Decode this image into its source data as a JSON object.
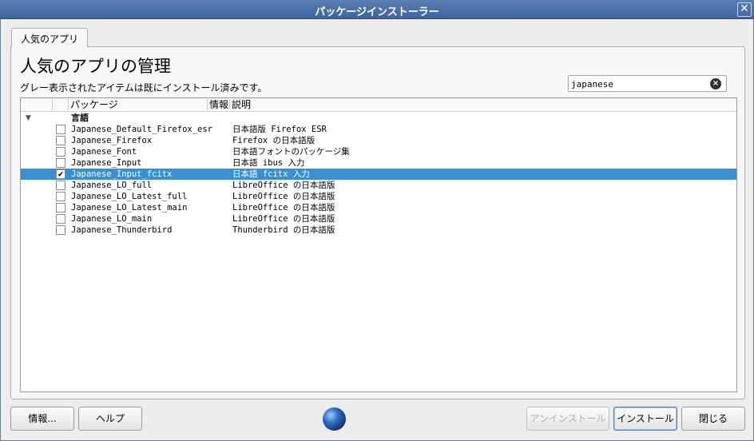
{
  "window": {
    "title": "パッケージインストーラー"
  },
  "tab": {
    "label": "人気のアプリ"
  },
  "heading": "人気のアプリの管理",
  "description": "グレー表示されたアイテムは既にインストール済みです。",
  "search": {
    "value": "japanese"
  },
  "columns": {
    "package": "パッケージ",
    "info": "情報",
    "desc": "説明"
  },
  "group": {
    "label": "言語"
  },
  "rows": [
    {
      "name": "Japanese_Default_Firefox_esr",
      "desc": "日本語版 Firefox ESR",
      "checked": false
    },
    {
      "name": "Japanese_Firefox",
      "desc": "Firefox の日本語版",
      "checked": false
    },
    {
      "name": "Japanese_Font",
      "desc": "日本語フォントのパッケージ集",
      "checked": false
    },
    {
      "name": "Japanese_Input",
      "desc": "日本語 ibus 入力",
      "checked": false
    },
    {
      "name": "Japanese_Input_fcitx",
      "desc": "日本語 fcitx 入力",
      "checked": true
    },
    {
      "name": "Japanese_LO_full",
      "desc": "LibreOffice の日本語版",
      "checked": false
    },
    {
      "name": "Japanese_LO_Latest_full",
      "desc": "LibreOffice の日本語版",
      "checked": false
    },
    {
      "name": "Japanese_LO_Latest_main",
      "desc": "LibreOffice の日本語版",
      "checked": false
    },
    {
      "name": "Japanese_LO_main",
      "desc": "LibreOffice の日本語版",
      "checked": false
    },
    {
      "name": "Japanese_Thunderbird",
      "desc": "Thunderbird の日本語版",
      "checked": false
    }
  ],
  "buttons": {
    "info": "情報...",
    "help": "ヘルプ",
    "uninstall": "アンインストール",
    "install": "インストール",
    "close": "閉じる"
  },
  "icons": {
    "close": "close-icon",
    "clear": "clear-search-icon",
    "expand": "triangle-down-icon",
    "globe": "globe-icon",
    "check": "checkmark-icon"
  },
  "colors": {
    "titlebar": "#3e64a0",
    "selection": "#3a8fd0"
  }
}
